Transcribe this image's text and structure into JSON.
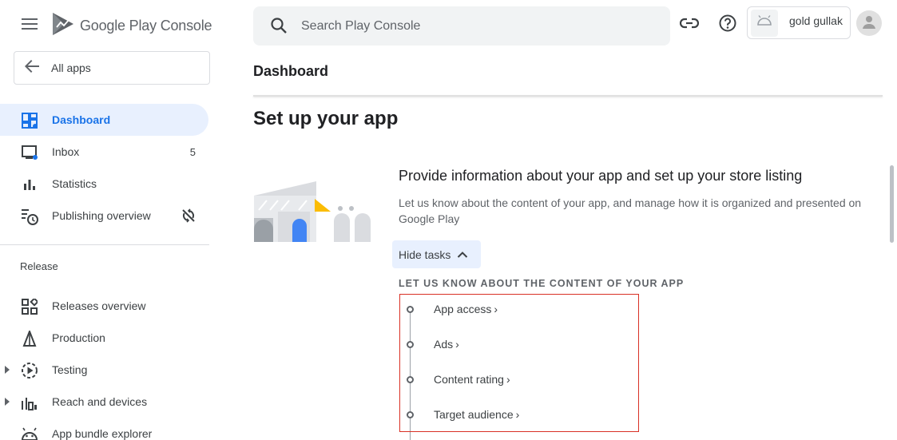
{
  "app": {
    "logo_google": "Google",
    "logo_play": "Play",
    "logo_console": "Console"
  },
  "sidebar": {
    "all_apps_label": "All apps",
    "items": [
      {
        "label": "Dashboard",
        "icon": "dashboard-icon",
        "active": true
      },
      {
        "label": "Inbox",
        "icon": "inbox-icon",
        "count": "5"
      },
      {
        "label": "Statistics",
        "icon": "bar-chart-icon"
      },
      {
        "label": "Publishing overview",
        "icon": "publishing-schedule-icon",
        "trailing_icon": "sync-disabled-icon"
      }
    ],
    "release_section_title": "Release",
    "release_items": [
      {
        "label": "Releases overview",
        "icon": "releases-overview-icon"
      },
      {
        "label": "Production",
        "icon": "production-icon"
      },
      {
        "label": "Testing",
        "icon": "testing-icon",
        "expandable": true
      },
      {
        "label": "Reach and devices",
        "icon": "reach-devices-icon",
        "expandable": true
      },
      {
        "label": "App bundle explorer",
        "icon": "android-icon"
      }
    ]
  },
  "search": {
    "placeholder": "Search Play Console",
    "value": ""
  },
  "account": {
    "name": "gold gullak"
  },
  "main": {
    "page_title": "Dashboard",
    "section_heading": "Set up your app",
    "card": {
      "title": "Provide information about your app and set up your store listing",
      "description": "Let us know about the content of your app, and manage how it is organized and presented on Google Play",
      "hide_tasks_label": "Hide tasks",
      "task_group_title": "LET US KNOW ABOUT THE CONTENT OF YOUR APP",
      "tasks": [
        {
          "label": "App access"
        },
        {
          "label": "Ads"
        },
        {
          "label": "Content rating"
        },
        {
          "label": "Target audience"
        }
      ]
    }
  },
  "colors": {
    "accent": "#1a73e8",
    "active_bg": "#e8f0fe",
    "highlight_border": "#d93025",
    "illustration_yellow": "#fbbc04"
  }
}
